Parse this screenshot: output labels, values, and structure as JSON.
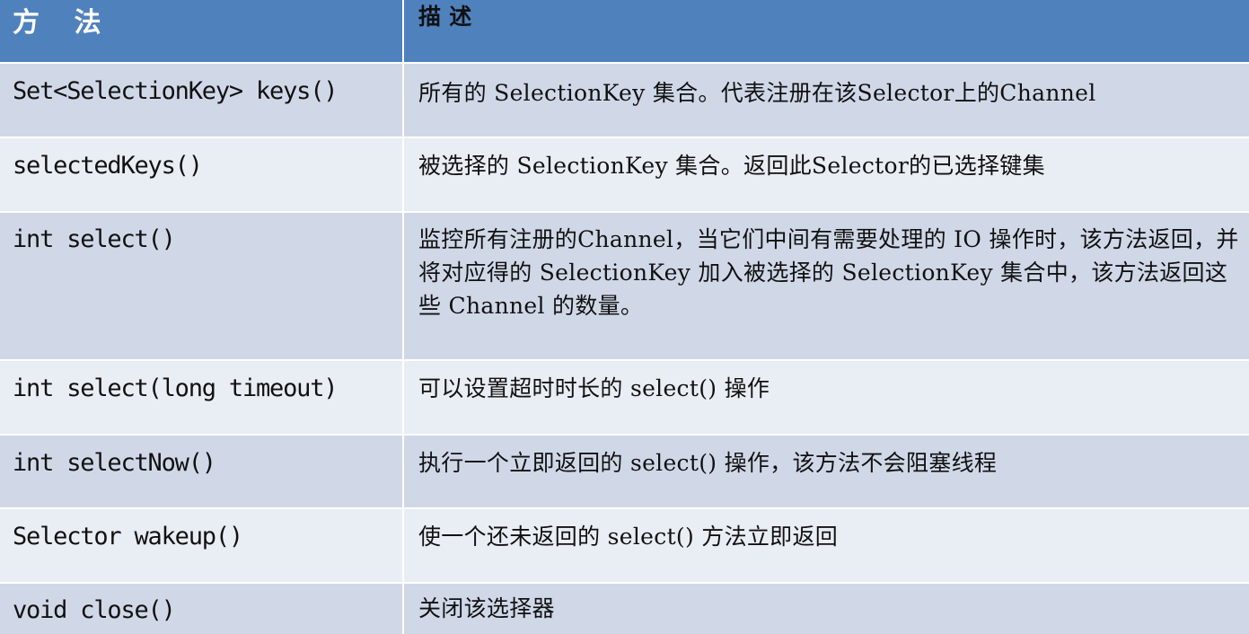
{
  "table": {
    "headers": {
      "method": "方 法",
      "description": "描 述"
    },
    "rows": [
      {
        "method": "Set<SelectionKey> keys()",
        "description": "所有的 SelectionKey 集合。代表注册在该Selector上的Channel"
      },
      {
        "method": "selectedKeys()",
        "description": "被选择的 SelectionKey 集合。返回此Selector的已选择键集"
      },
      {
        "method": "int select()",
        "description": "监控所有注册的Channel，当它们中间有需要处理的 IO 操作时，该方法返回，并将对应得的 SelectionKey 加入被选择的 SelectionKey 集合中，该方法返回这些 Channel 的数量。"
      },
      {
        "method": "int select(long timeout)",
        "description": "可以设置超时时长的 select() 操作"
      },
      {
        "method": "int selectNow()",
        "description": "执行一个立即返回的 select() 操作，该方法不会阻塞线程"
      },
      {
        "method": "Selector wakeup()",
        "description": "使一个还未返回的 select() 方法立即返回"
      },
      {
        "method": "void close()",
        "description": "关闭该选择器"
      }
    ]
  },
  "colors": {
    "header_bg": "#4f81bd",
    "header_text": "#ffffff",
    "row_odd_bg": "#d0d8e8",
    "row_even_bg": "#e9edf4",
    "grid_line": "#ffffff"
  }
}
